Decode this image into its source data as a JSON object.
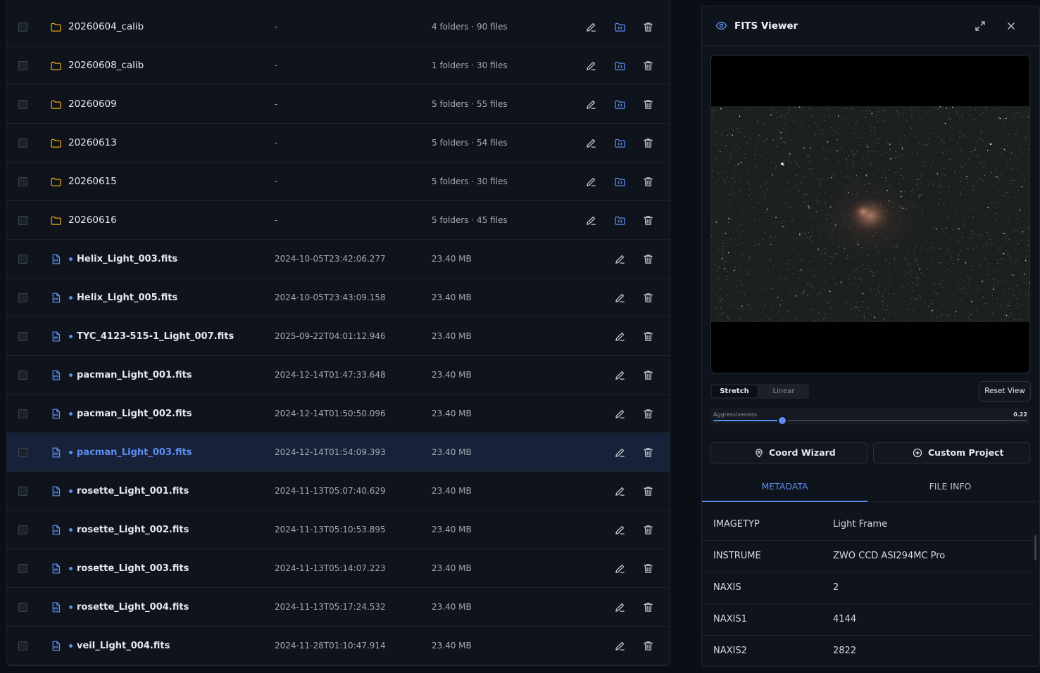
{
  "files": [
    {
      "kind": "folder",
      "name": "20260604_calib",
      "date": "-",
      "size": "4 folders · 90 files",
      "selected": false
    },
    {
      "kind": "folder",
      "name": "20260608_calib",
      "date": "-",
      "size": "1 folders · 30 files",
      "selected": false
    },
    {
      "kind": "folder",
      "name": "20260609",
      "date": "-",
      "size": "5 folders · 55 files",
      "selected": false
    },
    {
      "kind": "folder",
      "name": "20260613",
      "date": "-",
      "size": "5 folders · 54 files",
      "selected": false
    },
    {
      "kind": "folder",
      "name": "20260615",
      "date": "-",
      "size": "5 folders · 30 files",
      "selected": false
    },
    {
      "kind": "folder",
      "name": "20260616",
      "date": "-",
      "size": "5 folders · 45 files",
      "selected": false
    },
    {
      "kind": "file",
      "name": "Helix_Light_003.fits",
      "date": "2024-10-05T23:42:06.277",
      "size": "23.40 MB",
      "selected": false
    },
    {
      "kind": "file",
      "name": "Helix_Light_005.fits",
      "date": "2024-10-05T23:43:09.158",
      "size": "23.40 MB",
      "selected": false
    },
    {
      "kind": "file",
      "name": "TYC_4123-515-1_Light_007.fits",
      "date": "2025-09-22T04:01:12.946",
      "size": "23.40 MB",
      "selected": false
    },
    {
      "kind": "file",
      "name": "pacman_Light_001.fits",
      "date": "2024-12-14T01:47:33.648",
      "size": "23.40 MB",
      "selected": false
    },
    {
      "kind": "file",
      "name": "pacman_Light_002.fits",
      "date": "2024-12-14T01:50:50.096",
      "size": "23.40 MB",
      "selected": false
    },
    {
      "kind": "file",
      "name": "pacman_Light_003.fits",
      "date": "2024-12-14T01:54:09.393",
      "size": "23.40 MB",
      "selected": true
    },
    {
      "kind": "file",
      "name": "rosette_Light_001.fits",
      "date": "2024-11-13T05:07:40.629",
      "size": "23.40 MB",
      "selected": false
    },
    {
      "kind": "file",
      "name": "rosette_Light_002.fits",
      "date": "2024-11-13T05:10:53.895",
      "size": "23.40 MB",
      "selected": false
    },
    {
      "kind": "file",
      "name": "rosette_Light_003.fits",
      "date": "2024-11-13T05:14:07.223",
      "size": "23.40 MB",
      "selected": false
    },
    {
      "kind": "file",
      "name": "rosette_Light_004.fits",
      "date": "2024-11-13T05:17:24.532",
      "size": "23.40 MB",
      "selected": false
    },
    {
      "kind": "file",
      "name": "veil_Light_004.fits",
      "date": "2024-11-28T01:10:47.914",
      "size": "23.40 MB",
      "selected": false
    }
  ],
  "icons": {
    "folder": "folder-icon",
    "file": "fits-file-icon",
    "edit": "pencil-icon",
    "open": "folder-open-icon",
    "delete": "trash-icon"
  },
  "colors": {
    "accent": "#5b8def",
    "folder": "#e6a817",
    "selected_row": "#17223a"
  },
  "viewer": {
    "title": "FITS Viewer",
    "modes": [
      "Stretch",
      "Linear"
    ],
    "active_mode": "Stretch",
    "reset_label": "Reset View",
    "slider": {
      "label": "Aggressiveness",
      "value": 0.22,
      "value_text": "0.22"
    },
    "coord_label": "Coord Wizard",
    "custom_label": "Custom Project",
    "tabs": [
      "METADATA",
      "FILE INFO"
    ],
    "active_tab": "METADATA",
    "metadata": [
      {
        "key": "IMAGETYP",
        "value": "Light Frame"
      },
      {
        "key": "INSTRUME",
        "value": "ZWO CCD ASI294MC Pro"
      },
      {
        "key": "NAXIS",
        "value": "2"
      },
      {
        "key": "NAXIS1",
        "value": "4144"
      },
      {
        "key": "NAXIS2",
        "value": "2822"
      }
    ]
  }
}
